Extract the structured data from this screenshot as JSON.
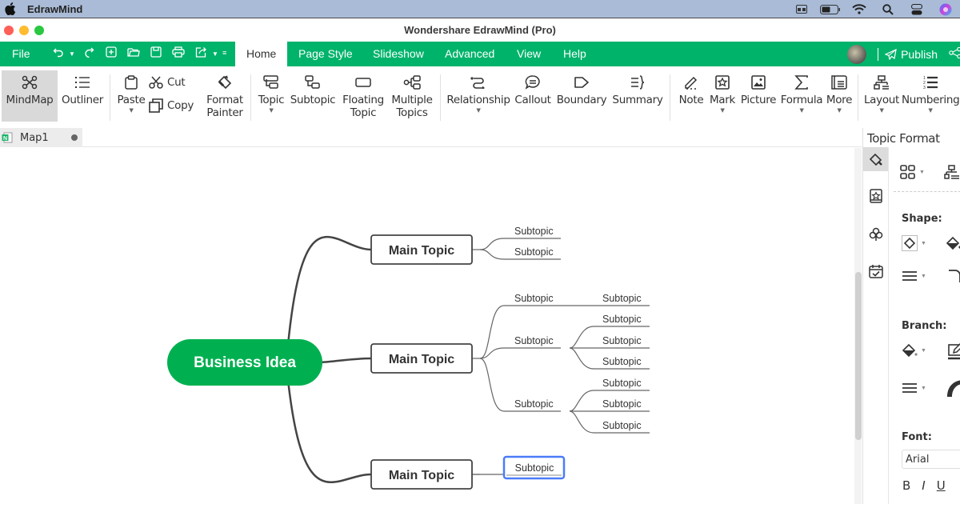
{
  "system_menubar": {
    "app_name": "EdrawMind",
    "tray_icons": [
      "screen-icon",
      "battery-icon",
      "wifi-icon",
      "search-icon",
      "control-center-icon",
      "siri-icon"
    ]
  },
  "window": {
    "title": "Wondershare EdrawMind (Pro)"
  },
  "tabs_bar": {
    "file_label": "File",
    "quick_access": [
      "undo-icon",
      "redo-icon",
      "new-icon",
      "open-icon",
      "save-icon",
      "print-icon",
      "export-icon",
      "customize-icon"
    ],
    "tabs": [
      {
        "label": "Home",
        "active": true
      },
      {
        "label": "Page Style",
        "active": false
      },
      {
        "label": "Slideshow",
        "active": false
      },
      {
        "label": "Advanced",
        "active": false
      },
      {
        "label": "View",
        "active": false
      },
      {
        "label": "Help",
        "active": false
      }
    ],
    "publish_label": "Publish"
  },
  "ribbon": {
    "mindmap": "MindMap",
    "outliner": "Outliner",
    "paste": "Paste",
    "cut": "Cut",
    "copy": "Copy",
    "format_painter_1": "Format",
    "format_painter_2": "Painter",
    "topic": "Topic",
    "subtopic": "Subtopic",
    "floating_1": "Floating",
    "floating_2": "Topic",
    "multiple_1": "Multiple",
    "multiple_2": "Topics",
    "relationship": "Relationship",
    "callout": "Callout",
    "boundary": "Boundary",
    "summary": "Summary",
    "note": "Note",
    "mark": "Mark",
    "picture": "Picture",
    "formula": "Formula",
    "more": "More",
    "layout": "Layout",
    "numbering": "Numbering"
  },
  "document": {
    "tab_name": "Map1",
    "unsaved": true
  },
  "mindmap": {
    "central": "Business Idea",
    "central_color": "#00b050",
    "main_topics": [
      {
        "label": "Main Topic",
        "subtopics": [
          {
            "label": "Subtopic",
            "children": []
          },
          {
            "label": "Subtopic",
            "children": []
          }
        ]
      },
      {
        "label": "Main Topic",
        "subtopics": [
          {
            "label": "Subtopic",
            "children": [
              "Subtopic"
            ]
          },
          {
            "label": "Subtopic",
            "children": [
              "Subtopic",
              "Subtopic",
              "Subtopic"
            ]
          },
          {
            "label": "Subtopic",
            "children": [
              "Subtopic",
              "Subtopic",
              "Subtopic"
            ]
          }
        ]
      },
      {
        "label": "Main Topic",
        "subtopics": [
          {
            "label": "Subtopic",
            "children": [],
            "selected": true
          }
        ]
      }
    ],
    "selection_color": "#4a7cf7"
  },
  "panel": {
    "title": "Topic Format",
    "shape_label": "Shape:",
    "branch_label": "Branch:",
    "font_label": "Font:",
    "font_value": "Arial",
    "bold": "B",
    "italic": "I",
    "underline": "U"
  }
}
